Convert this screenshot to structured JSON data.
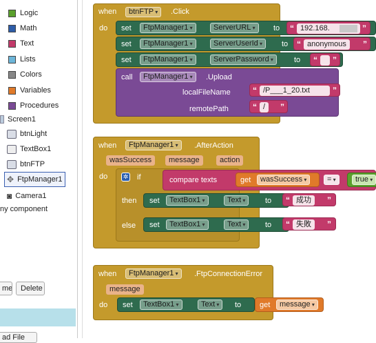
{
  "sidebar": {
    "categories": [
      {
        "label": "Logic",
        "color": "#5aa02c"
      },
      {
        "label": "Math",
        "color": "#2e5da8"
      },
      {
        "label": "Text",
        "color": "#c23a6a"
      },
      {
        "label": "Lists",
        "color": "#6db6d9"
      },
      {
        "label": "Colors",
        "color": "#888888"
      },
      {
        "label": "Variables",
        "color": "#e07a2a"
      },
      {
        "label": "Procedures",
        "color": "#7a4a95"
      }
    ],
    "screen_label": "Screen1",
    "components": [
      "btnLight",
      "TextBox1",
      "btnFTP",
      "FtpManager1",
      "Camera1"
    ],
    "any_component": "ny component",
    "rename_button": "me",
    "delete_button": "Delete",
    "upload_button": "ad File"
  },
  "blocks": {
    "when": "when",
    "do": "do",
    "set": "set",
    "to": "to",
    "call": "call",
    "click_event": {
      "component": "btnFTP",
      "event": ".Click",
      "rows": [
        {
          "component": "FtpManager1",
          "property": "ServerURL",
          "value": "192.168."
        },
        {
          "component": "FtpManager1",
          "property": "ServerUserId",
          "value": "anonymous"
        },
        {
          "component": "FtpManager1",
          "property": "ServerPassword",
          "value": ""
        }
      ],
      "upload": {
        "component": "FtpManager1",
        "method": ".Upload",
        "param1_label": "localFileName",
        "param1_value": "/P___1_20.txt",
        "param2_label": "remotePath",
        "param2_value": "/"
      }
    },
    "after_action": {
      "component": "FtpManager1",
      "event": ".AfterAction",
      "params": [
        "wasSuccess",
        "message",
        "action"
      ],
      "if": "if",
      "then": "then",
      "else": "else",
      "compare": "compare texts",
      "get": "get",
      "get_var": "wasSuccess",
      "op": "=",
      "true": "true",
      "then_target": "TextBox1",
      "then_prop": "Text",
      "then_value": "成功",
      "else_target": "TextBox1",
      "else_prop": "Text",
      "else_value": "失敗"
    },
    "conn_error": {
      "component": "FtpManager1",
      "event": ".FtpConnectionError",
      "param": "message",
      "target": "TextBox1",
      "prop": "Text",
      "get": "get",
      "get_var": "message"
    }
  }
}
